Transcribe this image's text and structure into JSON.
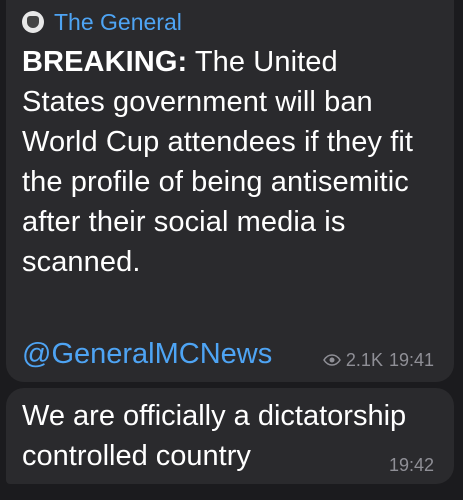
{
  "channel": {
    "name": "The General"
  },
  "posts": [
    {
      "prefix": "BREAKING:",
      "text": " The United States government will ban World Cup attendees if they fit the profile of being antisemitic after their social media is scanned.",
      "link": "@GeneralMCNews",
      "views": "2.1K",
      "time": "19:41"
    },
    {
      "text": "We are officially a dictatorship controlled country",
      "time": "19:42"
    }
  ],
  "icons": {
    "avatar": "avatar-icon",
    "views": "eye-icon"
  },
  "colors": {
    "background": "#1b1b1e",
    "bubble": "#2a2a2d",
    "accent": "#4ea4f4",
    "text": "#ffffff",
    "meta": "#8f8f96"
  }
}
